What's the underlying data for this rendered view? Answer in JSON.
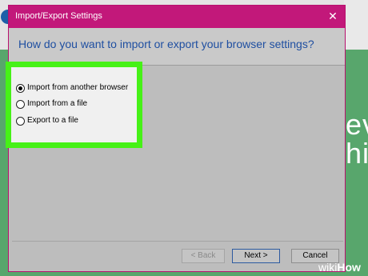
{
  "dialog": {
    "title": "Import/Export Settings",
    "close_icon": "close-icon",
    "heading": "How do you want to import or export your browser settings?",
    "options": [
      {
        "label": "Import from another browser",
        "selected": true
      },
      {
        "label": "Import from a file",
        "selected": false
      },
      {
        "label": "Export to a file",
        "selected": false
      }
    ],
    "buttons": {
      "back": "< Back",
      "next": "Next >",
      "cancel": "Cancel"
    }
  },
  "background": {
    "text": "ev\nhi"
  },
  "watermark": {
    "part1": "wiki",
    "part2": "How"
  },
  "colors": {
    "titlebar": "#c2187a",
    "highlight": "#46f117",
    "heading": "#1f4fa1"
  }
}
